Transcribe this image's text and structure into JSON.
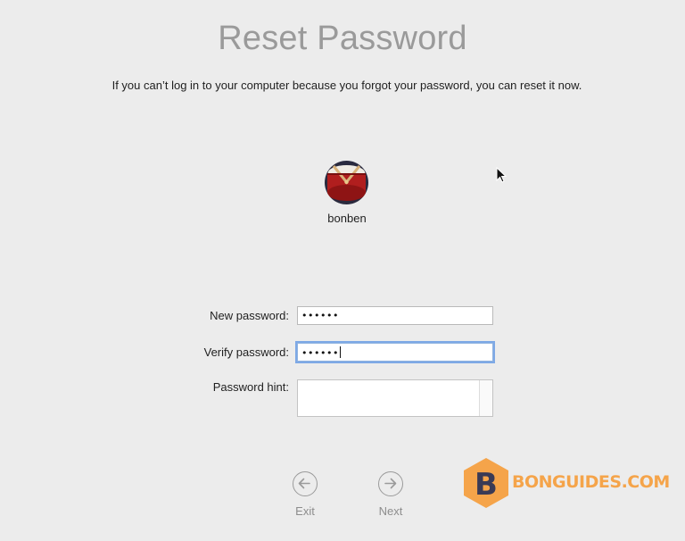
{
  "header": {
    "title": "Reset Password",
    "subtitle": "If you can’t log in to your computer because you forgot your password, you can reset it now."
  },
  "user": {
    "name": "bonben",
    "avatar_icon": "avatar-drum-icon"
  },
  "form": {
    "new_password_label": "New password:",
    "new_password_value": "••••••",
    "verify_password_label": "Verify password:",
    "verify_password_value": "••••••",
    "password_hint_label": "Password hint:",
    "password_hint_value": ""
  },
  "nav": {
    "exit_label": "Exit",
    "exit_icon": "arrow-left-circle-icon",
    "next_label": "Next",
    "next_icon": "arrow-right-circle-icon"
  },
  "watermark": {
    "text": "BONGUIDES.COM",
    "badge_letter": "B",
    "color": "#f5a44a"
  },
  "colors": {
    "background": "#ececec",
    "title": "#9a9a9a",
    "focus_ring": "#7ea9e6"
  }
}
